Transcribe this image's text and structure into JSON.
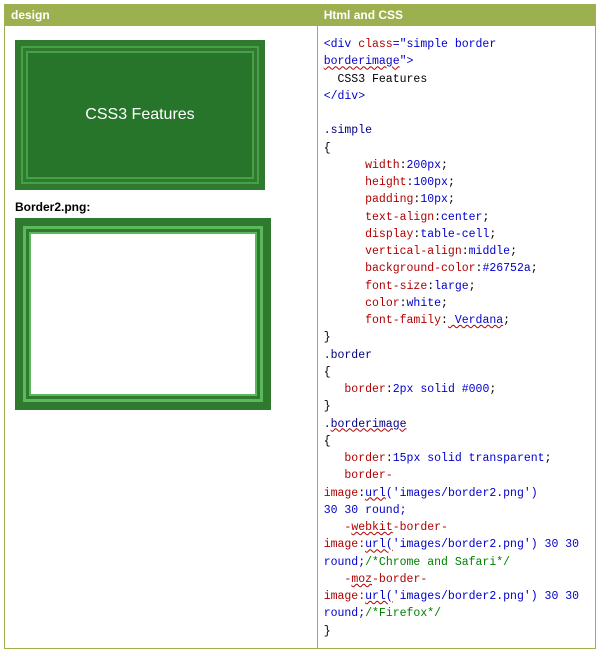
{
  "headers": {
    "left": "design",
    "right": "Html and CSS"
  },
  "demo_text": "CSS3 Features",
  "border_image_label": "Border2.png:",
  "code": {
    "l1a": "<div ",
    "l1b": "class",
    "l1c": "=\"simple border ",
    "l1d": "borderimage",
    "l1e": "\">",
    "l2": "  CSS3 Features",
    "l3": "</div>",
    "blank1": "",
    "sel1": ".simple",
    "ob": "{",
    "p_width_k": "width",
    "p_width_v": "200px",
    "p_height_k": "height",
    "p_height_v": "100px",
    "p_padding_k": "padding",
    "p_padding_v": "10px",
    "p_ta_k": "text-align",
    "p_ta_v": "center",
    "p_disp_k": "display",
    "p_disp_v": "table-cell",
    "p_va_k": "vertical-align",
    "p_va_v": "middle",
    "p_bg_k": "background-color",
    "p_bg_v": "#26752a",
    "p_fs_k": "font-size",
    "p_fs_v": "large",
    "p_col_k": "color",
    "p_col_v": "white",
    "p_ff_k": "font-family",
    "p_ff_v": " Verdana",
    "cb": "}",
    "sel2": ".border",
    "p_border_k": "border",
    "p_border_v": "2px solid #000",
    "sel3a": ".",
    "sel3b": "borderimage",
    "p_b15_k": "border",
    "p_b15_v": "15px solid transparent",
    "p_bi_k": "border-image",
    "p_bi_url": "url",
    "p_bi_arg": "('images/border2.png')",
    "p_bi_rest": "30 30 round;",
    "wk_a": "-",
    "wk_b": "webkit",
    "wk_c": "-border-",
    "wk_d": "image:",
    "wk_u": "url(",
    "wk_arg": "'images/border2.png') 30 30",
    "wk_round": "round;",
    "wk_comment": "/*Chrome and Safari*/",
    "mz_a": "-",
    "mz_b": "moz",
    "mz_c": "-border-",
    "mz_d": "image:",
    "mz_u": "url(",
    "mz_arg": "'images/border2.png') 30 30",
    "mz_round": "round;",
    "mz_comment": "/*Firefox*/",
    "semi": ";",
    "colon": ":"
  }
}
